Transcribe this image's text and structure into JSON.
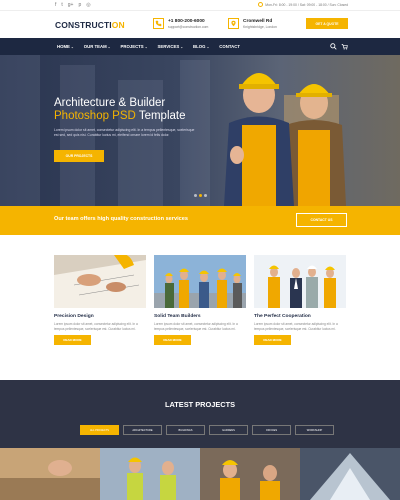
{
  "topbar": {
    "hours": "Mon-Fri: 8:00 - 19:00 / Sat: 09:00 - 18:00 / Sun: Closed"
  },
  "header": {
    "logo_main": "CONSTRUCTI",
    "logo_accent": "ON",
    "phone": "+1 800-200-6000",
    "email": "support@construction.com",
    "address_title": "Cromwell Rd",
    "address_sub": "Knightsbridge, London",
    "quote_label": "GET A QUOTE"
  },
  "nav": {
    "items": [
      {
        "label": "HOME",
        "dropdown": true,
        "active": false
      },
      {
        "label": "OUR TEAM",
        "dropdown": true,
        "active": false
      },
      {
        "label": "PROJECTS",
        "dropdown": true,
        "active": false
      },
      {
        "label": "SERVICES",
        "dropdown": true,
        "active": false
      },
      {
        "label": "BLOG",
        "dropdown": true,
        "active": false
      },
      {
        "label": "CONTACT",
        "dropdown": false,
        "active": false
      }
    ]
  },
  "hero": {
    "title_line1": "Architecture & Builder",
    "title_highlight": "Photoshop PSD",
    "title_rest": " Template",
    "text": "Lorem ipsum dolor sit amet, consectetur adipiscing elit. In a tempus pellentesque, scelerisque est sed, sed quis nisi. Curabitur luctus mi, eleifend ornare lorem id felis dolor.",
    "button": "OUR PROJECTS",
    "slides": 3,
    "active_slide": 2
  },
  "band": {
    "text": "Our team offers high quality construction services",
    "button": "CONTACT US"
  },
  "services": [
    {
      "title": "Precision Design",
      "text": "Lorem ipsum dolor sit amet, consectetur adipiscing elit. In a tempus pellentesque, scelerisque est. Curabitur luctus mi.",
      "button": "READ MORE"
    },
    {
      "title": "Solid Team Builders",
      "text": "Lorem ipsum dolor sit amet, consectetur adipiscing elit. In a tempus pellentesque, scelerisque est. Curabitur luctus mi.",
      "button": "READ MORE"
    },
    {
      "title": "The Perfect Cooperation",
      "text": "Lorem ipsum dolor sit amet, consectetur adipiscing elit. In a tempus pellentesque, scelerisque est. Curabitur luctus mi.",
      "button": "READ MORE"
    }
  ],
  "projects": {
    "title": "LATEST PROJECTS",
    "filters": [
      "ALL PROJECTS",
      "ARCHITECTURE",
      "BUILDINGS",
      "GARDENS",
      "OFFICES",
      "WORKSHOP"
    ],
    "active_filter": 0
  },
  "colors": {
    "accent": "#f5b400",
    "navy": "#1d2841",
    "dark": "#2e3345"
  },
  "icons": [
    "phone-icon",
    "location-icon",
    "clock-icon",
    "search-icon",
    "cart-icon",
    "facebook-icon",
    "twitter-icon",
    "googleplus-icon",
    "pinterest-icon",
    "instagram-icon"
  ]
}
